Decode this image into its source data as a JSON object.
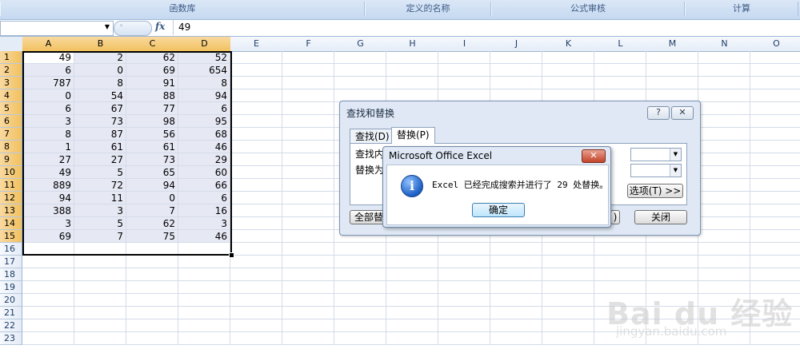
{
  "ribbon": {
    "groups": [
      {
        "label": "函数库"
      },
      {
        "label": "定义的名称"
      },
      {
        "label": "公式审核"
      },
      {
        "label": "计算"
      }
    ]
  },
  "formula_bar": {
    "name_box": "",
    "fx_label": "fx",
    "value": "49"
  },
  "sheet": {
    "columns": [
      "A",
      "B",
      "C",
      "D",
      "E",
      "F",
      "G",
      "H",
      "I",
      "J",
      "K",
      "L",
      "M",
      "N",
      "O"
    ],
    "selected_columns": [
      "A",
      "B",
      "C",
      "D"
    ],
    "row_count": 23,
    "selected_row_count": 15,
    "data": [
      [
        49,
        2,
        62,
        52
      ],
      [
        6,
        0,
        69,
        654
      ],
      [
        787,
        8,
        91,
        8
      ],
      [
        0,
        54,
        88,
        94
      ],
      [
        6,
        67,
        77,
        6
      ],
      [
        3,
        73,
        98,
        95
      ],
      [
        8,
        87,
        56,
        68
      ],
      [
        1,
        61,
        61,
        46
      ],
      [
        27,
        27,
        73,
        29
      ],
      [
        49,
        5,
        65,
        60
      ],
      [
        889,
        72,
        94,
        66
      ],
      [
        94,
        11,
        0,
        6
      ],
      [
        388,
        3,
        7,
        16
      ],
      [
        3,
        5,
        62,
        3
      ],
      [
        69,
        7,
        75,
        46
      ]
    ]
  },
  "find_replace": {
    "title": "查找和替换",
    "help_label": "?",
    "close_label": "✕",
    "tab_find": "查找(D)",
    "tab_replace": "替换(P)",
    "find_label": "查找内",
    "replace_label": "替换为",
    "options_label": "选项(T) >>",
    "replace_all_label": "全部替",
    "partial_button_label": ")",
    "close_button_label": "关闭"
  },
  "message_box": {
    "title": "Microsoft Office Excel",
    "close_label": "✕",
    "icon": "info-icon",
    "message": "Excel 已经完成搜索并进行了 29 处替换。",
    "ok_label": "确定"
  },
  "watermark": {
    "brand": "Bai du 经验",
    "url": "jingyan.baidu.com"
  }
}
